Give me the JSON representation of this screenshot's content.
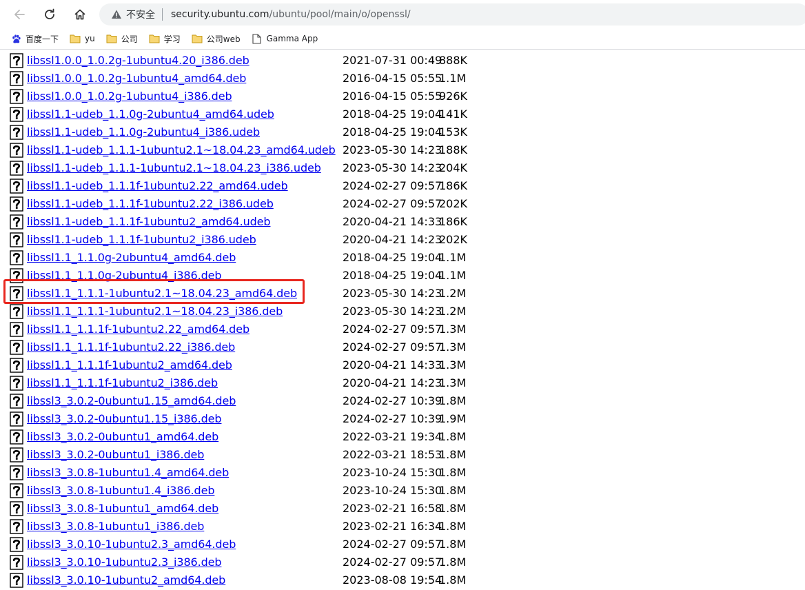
{
  "toolbar": {
    "insecure_label": "不安全",
    "url_host": "security.ubuntu.com",
    "url_path": "/ubuntu/pool/main/o/openssl/"
  },
  "bookmarks": [
    {
      "label": "百度一下",
      "icon": "baidu-paw-icon"
    },
    {
      "label": "yu",
      "icon": "folder-icon"
    },
    {
      "label": "公司",
      "icon": "folder-icon"
    },
    {
      "label": "学习",
      "icon": "folder-icon"
    },
    {
      "label": "公司web",
      "icon": "folder-icon"
    },
    {
      "label": "Gamma App",
      "icon": "page-icon"
    }
  ],
  "files": [
    {
      "name": "libssl1.0.0_1.0.2g-1ubuntu4.20_i386.deb",
      "date": "2021-07-31 00:49",
      "size": "888K"
    },
    {
      "name": "libssl1.0.0_1.0.2g-1ubuntu4_amd64.deb",
      "date": "2016-04-15 05:55",
      "size": "1.1M"
    },
    {
      "name": "libssl1.0.0_1.0.2g-1ubuntu4_i386.deb",
      "date": "2016-04-15 05:55",
      "size": "926K"
    },
    {
      "name": "libssl1.1-udeb_1.1.0g-2ubuntu4_amd64.udeb",
      "date": "2018-04-25 19:04",
      "size": "141K"
    },
    {
      "name": "libssl1.1-udeb_1.1.0g-2ubuntu4_i386.udeb",
      "date": "2018-04-25 19:04",
      "size": "153K"
    },
    {
      "name": "libssl1.1-udeb_1.1.1-1ubuntu2.1~18.04.23_amd64.udeb",
      "date": "2023-05-30 14:23",
      "size": "188K"
    },
    {
      "name": "libssl1.1-udeb_1.1.1-1ubuntu2.1~18.04.23_i386.udeb",
      "date": "2023-05-30 14:23",
      "size": "204K"
    },
    {
      "name": "libssl1.1-udeb_1.1.1f-1ubuntu2.22_amd64.udeb",
      "date": "2024-02-27 09:57",
      "size": "186K"
    },
    {
      "name": "libssl1.1-udeb_1.1.1f-1ubuntu2.22_i386.udeb",
      "date": "2024-02-27 09:57",
      "size": "202K"
    },
    {
      "name": "libssl1.1-udeb_1.1.1f-1ubuntu2_amd64.udeb",
      "date": "2020-04-21 14:33",
      "size": "186K"
    },
    {
      "name": "libssl1.1-udeb_1.1.1f-1ubuntu2_i386.udeb",
      "date": "2020-04-21 14:23",
      "size": "202K"
    },
    {
      "name": "libssl1.1_1.1.0g-2ubuntu4_amd64.deb",
      "date": "2018-04-25 19:04",
      "size": "1.1M"
    },
    {
      "name": "libssl1.1_1.1.0g-2ubuntu4_i386.deb",
      "date": "2018-04-25 19:04",
      "size": "1.1M"
    },
    {
      "name": "libssl1.1_1.1.1-1ubuntu2.1~18.04.23_amd64.deb",
      "date": "2023-05-30 14:23",
      "size": "1.2M"
    },
    {
      "name": "libssl1.1_1.1.1-1ubuntu2.1~18.04.23_i386.deb",
      "date": "2023-05-30 14:23",
      "size": "1.2M"
    },
    {
      "name": "libssl1.1_1.1.1f-1ubuntu2.22_amd64.deb",
      "date": "2024-02-27 09:57",
      "size": "1.3M"
    },
    {
      "name": "libssl1.1_1.1.1f-1ubuntu2.22_i386.deb",
      "date": "2024-02-27 09:57",
      "size": "1.3M"
    },
    {
      "name": "libssl1.1_1.1.1f-1ubuntu2_amd64.deb",
      "date": "2020-04-21 14:33",
      "size": "1.3M"
    },
    {
      "name": "libssl1.1_1.1.1f-1ubuntu2_i386.deb",
      "date": "2020-04-21 14:23",
      "size": "1.3M"
    },
    {
      "name": "libssl3_3.0.2-0ubuntu1.15_amd64.deb",
      "date": "2024-02-27 10:39",
      "size": "1.8M"
    },
    {
      "name": "libssl3_3.0.2-0ubuntu1.15_i386.deb",
      "date": "2024-02-27 10:39",
      "size": "1.9M"
    },
    {
      "name": "libssl3_3.0.2-0ubuntu1_amd64.deb",
      "date": "2022-03-21 19:34",
      "size": "1.8M"
    },
    {
      "name": "libssl3_3.0.2-0ubuntu1_i386.deb",
      "date": "2022-03-21 18:53",
      "size": "1.8M"
    },
    {
      "name": "libssl3_3.0.8-1ubuntu1.4_amd64.deb",
      "date": "2023-10-24 15:30",
      "size": "1.8M"
    },
    {
      "name": "libssl3_3.0.8-1ubuntu1.4_i386.deb",
      "date": "2023-10-24 15:30",
      "size": "1.8M"
    },
    {
      "name": "libssl3_3.0.8-1ubuntu1_amd64.deb",
      "date": "2023-02-21 16:58",
      "size": "1.8M"
    },
    {
      "name": "libssl3_3.0.8-1ubuntu1_i386.deb",
      "date": "2023-02-21 16:34",
      "size": "1.8M"
    },
    {
      "name": "libssl3_3.0.10-1ubuntu2.3_amd64.deb",
      "date": "2024-02-27 09:57",
      "size": "1.8M"
    },
    {
      "name": "libssl3_3.0.10-1ubuntu2.3_i386.deb",
      "date": "2024-02-27 09:57",
      "size": "1.8M"
    },
    {
      "name": "libssl3_3.0.10-1ubuntu2_amd64.deb",
      "date": "2023-08-08 19:54",
      "size": "1.8M"
    }
  ],
  "highlight": {
    "file": "libssl1.1_1.1.1-1ubuntu2.1~18.04.23_amd64.deb",
    "color": "#e8271f"
  },
  "colors": {
    "link": "#0000ee",
    "address_bg": "#f1f3f4"
  }
}
